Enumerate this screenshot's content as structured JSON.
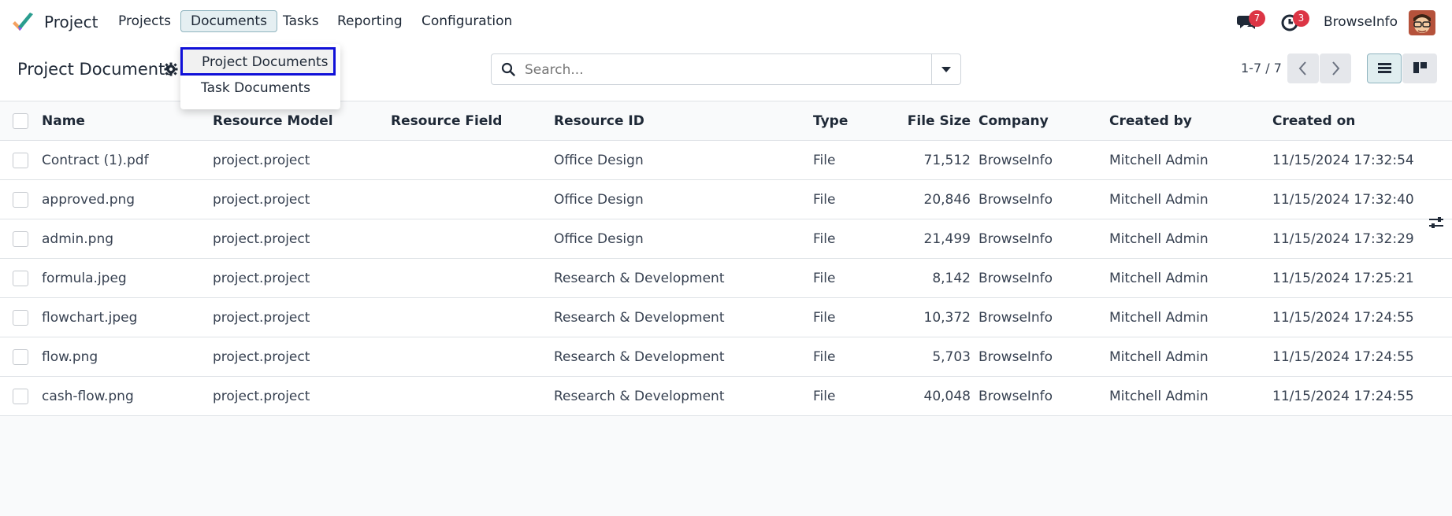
{
  "app": {
    "name": "Project"
  },
  "menu": {
    "items": [
      "Projects",
      "Documents",
      "Tasks",
      "Reporting",
      "Configuration"
    ],
    "active": "Documents"
  },
  "systray": {
    "messages_count": "7",
    "activities_count": "3",
    "company": "BrowseInfo"
  },
  "dropdown": {
    "items": [
      "Project Documents",
      "Task Documents"
    ],
    "highlighted": "Project Documents"
  },
  "control": {
    "title": "Project Documents",
    "search_placeholder": "Search...",
    "pager": "1-7 / 7"
  },
  "table": {
    "columns": [
      "Name",
      "Resource Model",
      "Resource Field",
      "Resource ID",
      "Type",
      "File Size",
      "Company",
      "Created by",
      "Created on"
    ],
    "rows": [
      [
        "Contract (1).pdf",
        "project.project",
        "",
        "Office Design",
        "File",
        "71,512",
        "BrowseInfo",
        "Mitchell Admin",
        "11/15/2024 17:32:54"
      ],
      [
        "approved.png",
        "project.project",
        "",
        "Office Design",
        "File",
        "20,846",
        "BrowseInfo",
        "Mitchell Admin",
        "11/15/2024 17:32:40"
      ],
      [
        "admin.png",
        "project.project",
        "",
        "Office Design",
        "File",
        "21,499",
        "BrowseInfo",
        "Mitchell Admin",
        "11/15/2024 17:32:29"
      ],
      [
        "formula.jpeg",
        "project.project",
        "",
        "Research & Development",
        "File",
        "8,142",
        "BrowseInfo",
        "Mitchell Admin",
        "11/15/2024 17:25:21"
      ],
      [
        "flowchart.jpeg",
        "project.project",
        "",
        "Research & Development",
        "File",
        "10,372",
        "BrowseInfo",
        "Mitchell Admin",
        "11/15/2024 17:24:55"
      ],
      [
        "flow.png",
        "project.project",
        "",
        "Research & Development",
        "File",
        "5,703",
        "BrowseInfo",
        "Mitchell Admin",
        "11/15/2024 17:24:55"
      ],
      [
        "cash-flow.png",
        "project.project",
        "",
        "Research & Development",
        "File",
        "40,048",
        "BrowseInfo",
        "Mitchell Admin",
        "11/15/2024 17:24:55"
      ]
    ]
  },
  "icons": {
    "logo": "project-logo-icon",
    "messages": "chat-bubbles-icon",
    "activities": "clock-icon",
    "gear": "gear-icon",
    "search": "search-icon",
    "toggle": "caret-down-icon",
    "prev": "chevron-left-icon",
    "next": "chevron-right-icon",
    "list_view": "list-view-icon",
    "kanban_view": "kanban-view-icon",
    "optional_columns": "sliders-icon"
  },
  "colors": {
    "accent": "#017e84",
    "badge": "#dc3545",
    "highlight_border": "#1010d8"
  }
}
